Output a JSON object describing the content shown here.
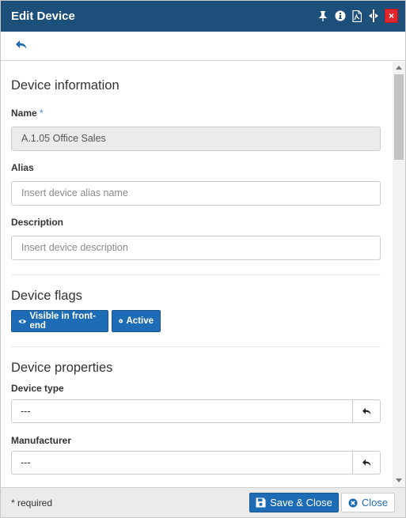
{
  "window": {
    "title": "Edit Device"
  },
  "titlebar_icons": [
    "pin-icon",
    "info-icon",
    "pdf-icon",
    "resize-icon",
    "close-icon"
  ],
  "titlebar_close_glyph": "×",
  "sections": {
    "info": {
      "title": "Device information",
      "name_label": "Name",
      "required_marker": "*",
      "name_value": "A.1.05 Office Sales",
      "alias_label": "Alias",
      "alias_placeholder": "Insert device alias name",
      "description_label": "Description",
      "description_placeholder": "Insert device description"
    },
    "flags": {
      "title": "Device flags",
      "visible_label": "Visible in front-end",
      "active_label": "Active"
    },
    "properties": {
      "title": "Device properties",
      "device_type_label": "Device type",
      "device_type_value": "---",
      "manufacturer_label": "Manufacturer",
      "manufacturer_value": "---"
    }
  },
  "footer": {
    "required_note": "* required",
    "save_label": "Save & Close",
    "close_label": "Close"
  },
  "colors": {
    "titlebar": "#1c4f7a",
    "primary": "#1e6cb5",
    "close_red": "#e0262b"
  }
}
